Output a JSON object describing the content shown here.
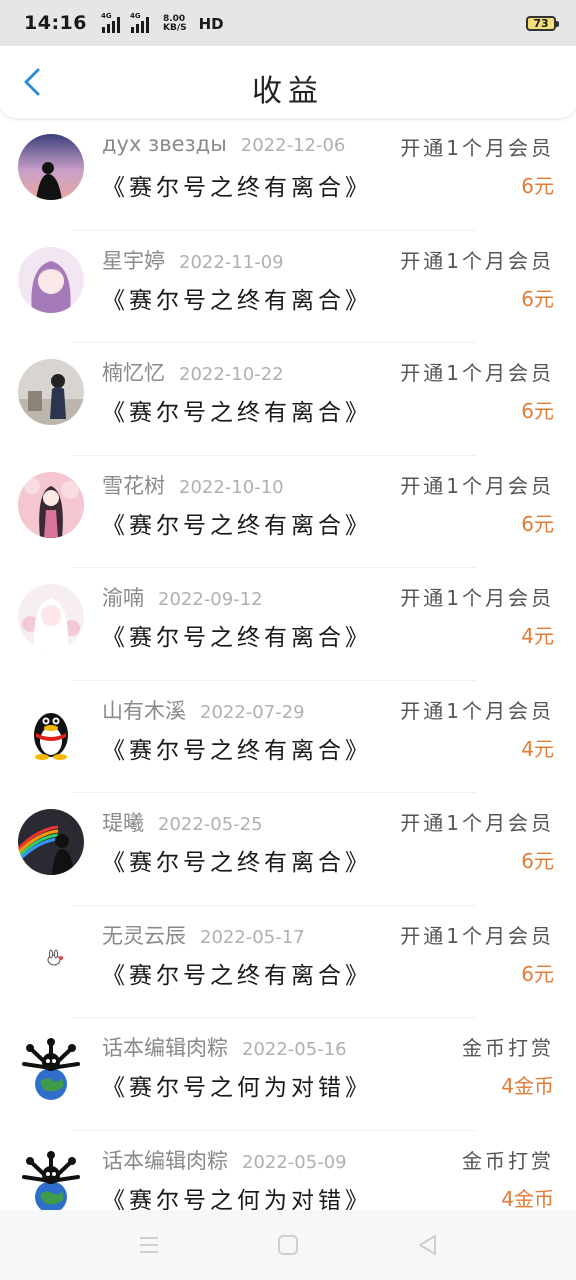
{
  "status_bar": {
    "time": "14:16",
    "signal_1_tag": "4G",
    "signal_2_tag": "4G",
    "net_speed_value": "8.00",
    "net_speed_unit": "KB/S",
    "hd_label": "HD",
    "battery": "73"
  },
  "header": {
    "title": "收益",
    "back_icon": "chevron-left-icon"
  },
  "records": [
    {
      "name": "дух звезды",
      "date": "2022-12-06",
      "work": "《赛尔号之终有离合》",
      "action": "开通1个月会员",
      "amount": "6元"
    },
    {
      "name": "星宇婷",
      "date": "2022-11-09",
      "work": "《赛尔号之终有离合》",
      "action": "开通1个月会员",
      "amount": "6元"
    },
    {
      "name": "楠忆忆",
      "date": "2022-10-22",
      "work": "《赛尔号之终有离合》",
      "action": "开通1个月会员",
      "amount": "6元"
    },
    {
      "name": "雪花树",
      "date": "2022-10-10",
      "work": "《赛尔号之终有离合》",
      "action": "开通1个月会员",
      "amount": "6元"
    },
    {
      "name": "渝喃",
      "date": "2022-09-12",
      "work": "《赛尔号之终有离合》",
      "action": "开通1个月会员",
      "amount": "4元"
    },
    {
      "name": "山有木溪",
      "date": "2022-07-29",
      "work": "《赛尔号之终有离合》",
      "action": "开通1个月会员",
      "amount": "4元"
    },
    {
      "name": "瑅曦",
      "date": "2022-05-25",
      "work": "《赛尔号之终有离合》",
      "action": "开通1个月会员",
      "amount": "6元"
    },
    {
      "name": "无灵云辰",
      "date": "2022-05-17",
      "work": "《赛尔号之终有离合》",
      "action": "开通1个月会员",
      "amount": "6元"
    },
    {
      "name": "话本编辑肉粽",
      "date": "2022-05-16",
      "work": "《赛尔号之何为对错》",
      "action": "金币打赏",
      "amount": "4金币"
    },
    {
      "name": "话本编辑肉粽",
      "date": "2022-05-09",
      "work": "《赛尔号之何为对错》",
      "action": "金币打赏",
      "amount": "4金币"
    }
  ],
  "nav": {
    "menu_icon": "menu-icon",
    "home_icon": "home-square-icon",
    "back_icon": "back-triangle-icon"
  },
  "colors": {
    "accent": "#2a8fd6",
    "amount": "#e27b35",
    "status_bar_bg": "#e6e6e6"
  }
}
